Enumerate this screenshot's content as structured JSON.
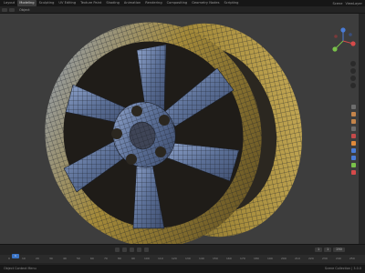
{
  "menu": {
    "items": [
      "Layout",
      "Modeling",
      "Sculpting",
      "UV Editing",
      "Texture Paint",
      "Shading",
      "Animation",
      "Rendering",
      "Compositing",
      "Geometry Nodes",
      "Scripting"
    ],
    "active_index": 1
  },
  "topbar": {
    "scene_label": "Scene",
    "view_layer_label": "ViewLayer"
  },
  "header": {
    "mode_label": "Object"
  },
  "timeline": {
    "ticks": [
      "0",
      "10",
      "20",
      "30",
      "40",
      "50",
      "60",
      "70",
      "80",
      "90",
      "100",
      "110",
      "120",
      "130",
      "140",
      "150",
      "160",
      "170",
      "180",
      "190",
      "200",
      "210",
      "220",
      "230",
      "240",
      "250"
    ],
    "current_frame": "1",
    "start": "1",
    "end": "250"
  },
  "status": {
    "left": "Object Context Menu",
    "right": "Scene Collection | 3.0.0"
  },
  "colors": {
    "viewport_bg": "#3d3d3d",
    "wheel_gold": "#a48a3a",
    "wheel_steel": "#5b6f96",
    "accent_blue": "#3a73c4"
  }
}
